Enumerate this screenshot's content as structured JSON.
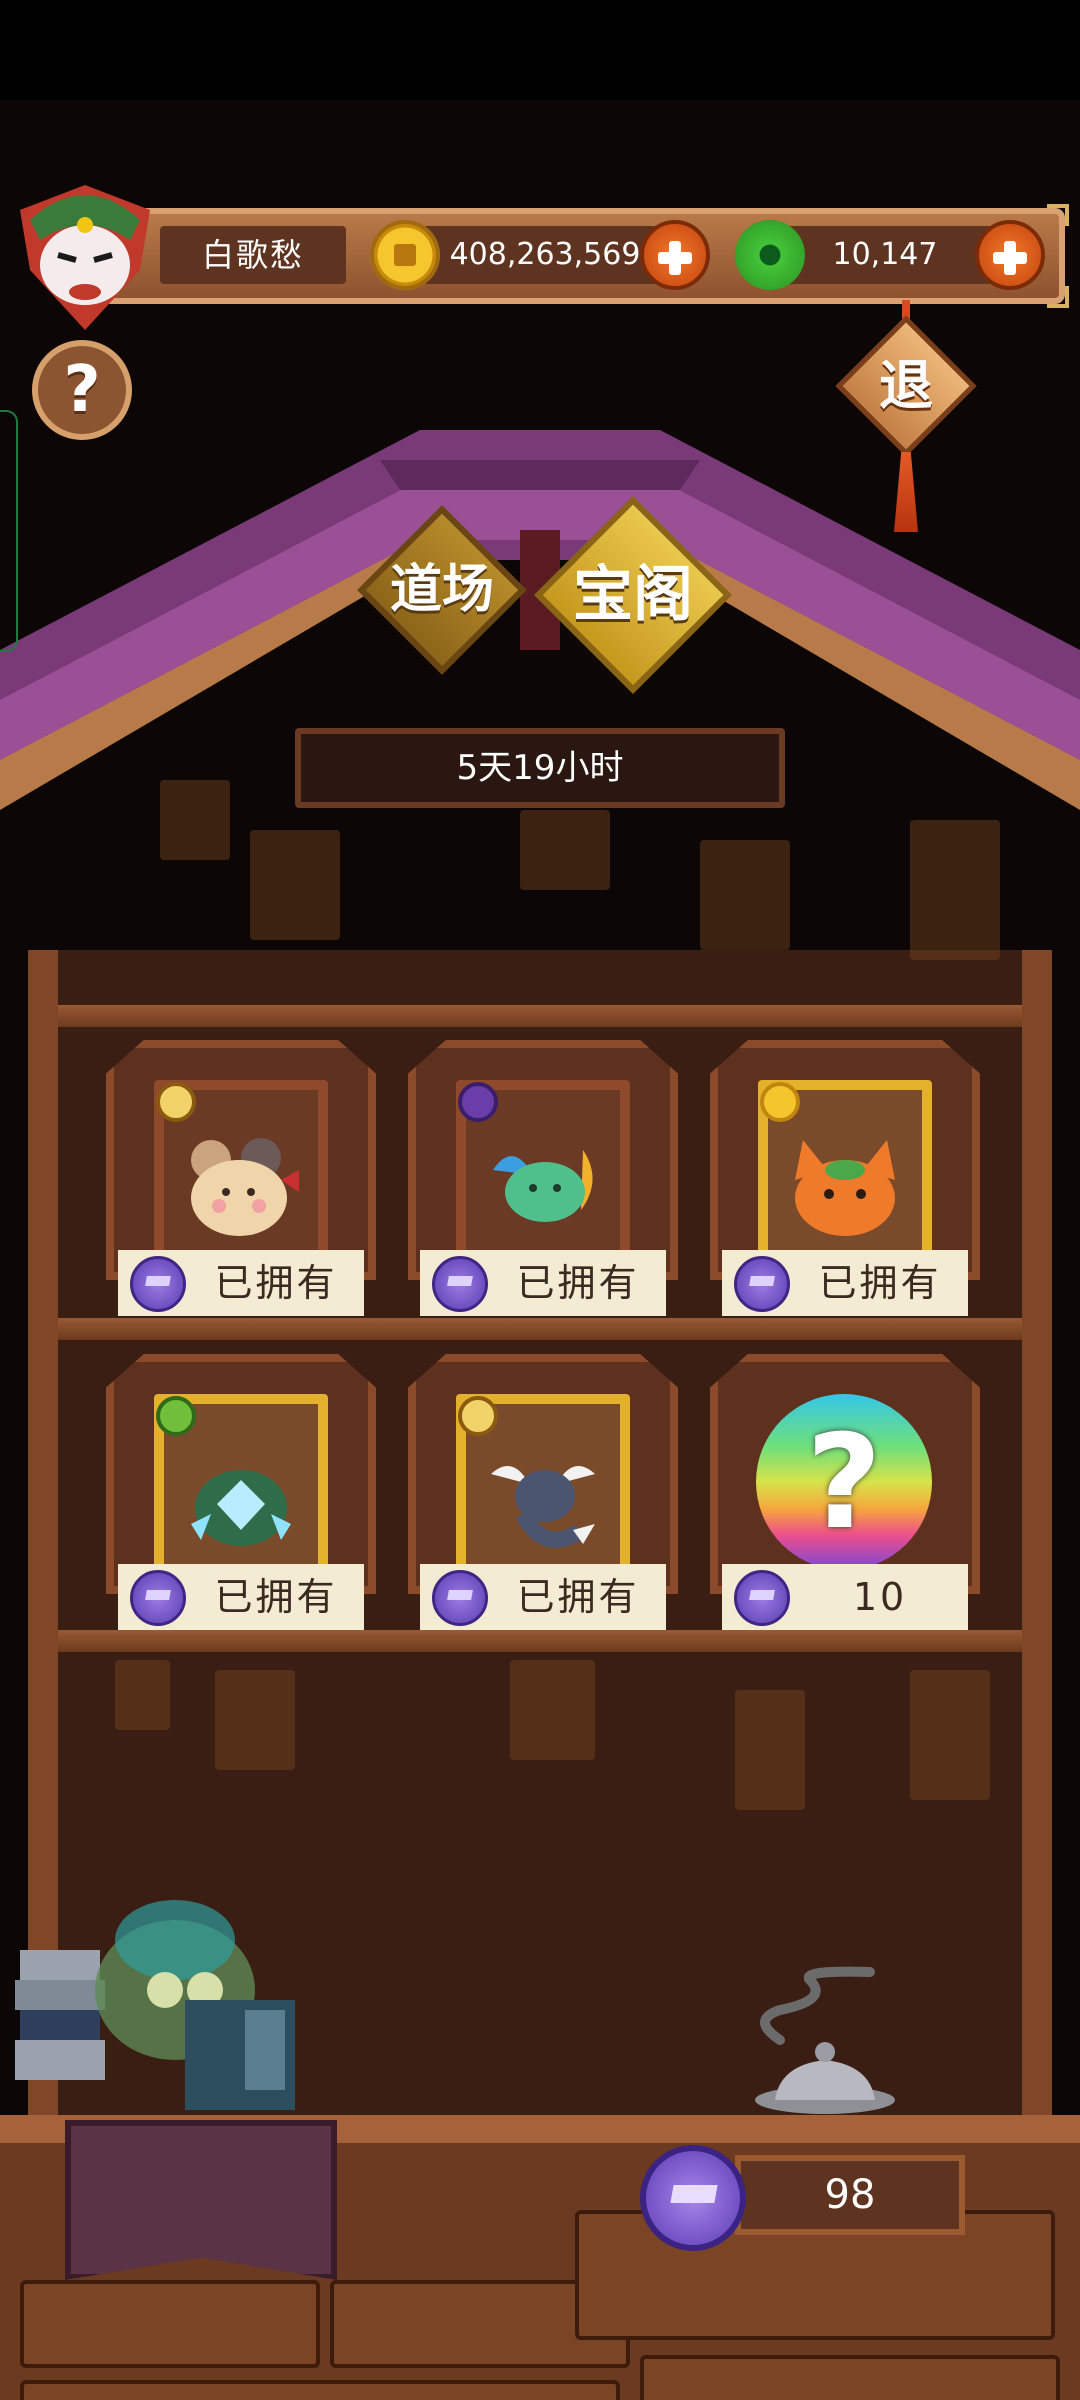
{
  "header": {
    "player_name": "白歌愁",
    "gold": "408,263,569",
    "jade": "10,147",
    "help_symbol": "?",
    "exit_label": "退"
  },
  "tabs": [
    {
      "label": "道场",
      "selected": false
    },
    {
      "label": "宝阁",
      "selected": true
    }
  ],
  "timer": "5天19小时",
  "shelf": {
    "items": [
      {
        "status": "已拥有",
        "rarity": "bronze",
        "pet": "mouse",
        "badge_icon": "triangle-icon"
      },
      {
        "status": "已拥有",
        "rarity": "bronze",
        "pet": "winged-fish",
        "badge_icon": "moon-icon"
      },
      {
        "status": "已拥有",
        "rarity": "gold",
        "pet": "fox",
        "badge_icon": "sun-icon"
      },
      {
        "status": "已拥有",
        "rarity": "gold",
        "pet": "crystal-dragon",
        "badge_icon": "leaf-icon"
      },
      {
        "status": "已拥有",
        "rarity": "gold",
        "pet": "winged-serpent",
        "badge_icon": "triangle-icon"
      },
      {
        "status": "10",
        "rarity": "mystery",
        "pet": "mystery-egg",
        "badge_icon": ""
      }
    ],
    "mystery_symbol": "?"
  },
  "footer": {
    "scholar_tokens": "98"
  },
  "colors": {
    "wood": "#7f4628",
    "roof_purple": "#7a3a78",
    "tab_gold": "#e9c84d",
    "token_purple": "#5a3bb2"
  }
}
